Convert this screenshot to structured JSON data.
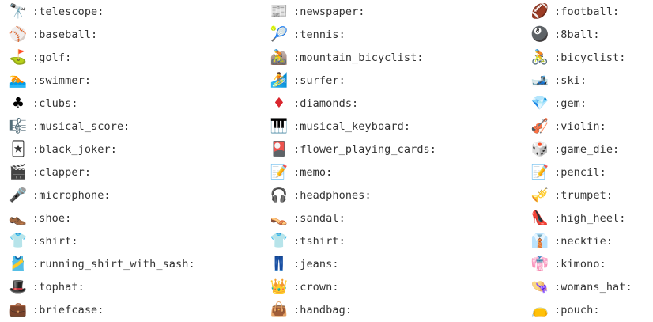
{
  "columns": [
    {
      "items": [
        {
          "code": ":telescope:",
          "icon": "telescope-icon",
          "glyph": "🔭",
          "color": "#4a4a4a"
        },
        {
          "code": ":baseball:",
          "icon": "baseball-icon",
          "glyph": "⚾",
          "color": "#c0392b"
        },
        {
          "code": ":golf:",
          "icon": "golf-flag-icon",
          "glyph": "⛳",
          "color": "#2e8b22"
        },
        {
          "code": ":swimmer:",
          "icon": "swimmer-icon",
          "glyph": "🏊",
          "color": "#1f7fc4"
        },
        {
          "code": ":clubs:",
          "icon": "clubs-card-icon",
          "glyph": "♣",
          "color": "#000000"
        },
        {
          "code": ":musical_score:",
          "icon": "musical-score-icon",
          "glyph": "🎼",
          "color": "#222222"
        },
        {
          "code": ":black_joker:",
          "icon": "black-joker-icon",
          "glyph": "🃏",
          "color": "#333333"
        },
        {
          "code": ":clapper:",
          "icon": "clapper-board-icon",
          "glyph": "🎬",
          "color": "#222222"
        },
        {
          "code": ":microphone:",
          "icon": "microphone-icon",
          "glyph": "🎤",
          "color": "#333333"
        },
        {
          "code": ":shoe:",
          "icon": "shoe-icon",
          "glyph": "👞",
          "color": "#888888"
        },
        {
          "code": ":shirt:",
          "icon": "shirt-icon",
          "glyph": "👕",
          "color": "#3a6fb5"
        },
        {
          "code": ":running_shirt_with_sash:",
          "icon": "running-shirt-icon",
          "glyph": "🎽",
          "color": "#2aa8e0"
        },
        {
          "code": ":tophat:",
          "icon": "tophat-icon",
          "glyph": "🎩",
          "color": "#111111"
        },
        {
          "code": ":briefcase:",
          "icon": "briefcase-icon",
          "glyph": "💼",
          "color": "#5a3b25"
        }
      ]
    },
    {
      "items": [
        {
          "code": ":newspaper:",
          "icon": "newspaper-icon",
          "glyph": "📰",
          "color": "#666666"
        },
        {
          "code": ":tennis:",
          "icon": "tennis-ball-icon",
          "glyph": "🎾",
          "color": "#7cc40a"
        },
        {
          "code": ":mountain_bicyclist:",
          "icon": "mountain-bicyclist-icon",
          "glyph": "🚵",
          "color": "#8a5a2b"
        },
        {
          "code": ":surfer:",
          "icon": "surfer-icon",
          "glyph": "🏄",
          "color": "#1e8f6e"
        },
        {
          "code": ":diamonds:",
          "icon": "diamonds-card-icon",
          "glyph": "♦",
          "color": "#d9262e"
        },
        {
          "code": ":musical_keyboard:",
          "icon": "musical-keyboard-icon",
          "glyph": "🎹",
          "color": "#111111"
        },
        {
          "code": ":flower_playing_cards:",
          "icon": "flower-playing-cards-icon",
          "glyph": "🎴",
          "color": "#b0201e"
        },
        {
          "code": ":memo:",
          "icon": "memo-icon",
          "glyph": "📝",
          "color": "#c9a000"
        },
        {
          "code": ":headphones:",
          "icon": "headphones-icon",
          "glyph": "🎧",
          "color": "#555555"
        },
        {
          "code": ":sandal:",
          "icon": "sandal-icon",
          "glyph": "👡",
          "color": "#c9a56a"
        },
        {
          "code": ":tshirt:",
          "icon": "tshirt-icon",
          "glyph": "👕",
          "color": "#3a6fb5"
        },
        {
          "code": ":jeans:",
          "icon": "jeans-icon",
          "glyph": "👖",
          "color": "#4b2a86"
        },
        {
          "code": ":crown:",
          "icon": "crown-icon",
          "glyph": "👑",
          "color": "#e0a800"
        },
        {
          "code": ":handbag:",
          "icon": "handbag-icon",
          "glyph": "👜",
          "color": "#8a5a2b"
        }
      ]
    },
    {
      "items": [
        {
          "code": ":football:",
          "icon": "football-icon",
          "glyph": "🏈",
          "color": "#7a3b1c"
        },
        {
          "code": ":8ball:",
          "icon": "8ball-icon",
          "glyph": "🎱",
          "color": "#111111"
        },
        {
          "code": ":bicyclist:",
          "icon": "bicyclist-icon",
          "glyph": "🚴",
          "color": "#2a7fb0"
        },
        {
          "code": ":ski:",
          "icon": "ski-icon",
          "glyph": "🎿",
          "color": "#2bb3a0"
        },
        {
          "code": ":gem:",
          "icon": "gem-icon",
          "glyph": "💎",
          "color": "#55b8e8"
        },
        {
          "code": ":violin:",
          "icon": "violin-icon",
          "glyph": "🎻",
          "color": "#9b3b14"
        },
        {
          "code": ":game_die:",
          "icon": "game-die-icon",
          "glyph": "🎲",
          "color": "#666666"
        },
        {
          "code": ":pencil:",
          "icon": "pencil-icon",
          "glyph": "📝",
          "color": "#c9a000"
        },
        {
          "code": ":trumpet:",
          "icon": "trumpet-icon",
          "glyph": "🎺",
          "color": "#d49a14"
        },
        {
          "code": ":high_heel:",
          "icon": "high-heel-icon",
          "glyph": "👠",
          "color": "#d8131b"
        },
        {
          "code": ":necktie:",
          "icon": "necktie-icon",
          "glyph": "👔",
          "color": "#3a6fb5"
        },
        {
          "code": ":kimono:",
          "icon": "kimono-icon",
          "glyph": "👘",
          "color": "#e07a10"
        },
        {
          "code": ":womans_hat:",
          "icon": "womans-hat-icon",
          "glyph": "👒",
          "color": "#6b8f2a"
        },
        {
          "code": ":pouch:",
          "icon": "pouch-icon",
          "glyph": "👝",
          "color": "#d9a44a"
        }
      ]
    }
  ]
}
